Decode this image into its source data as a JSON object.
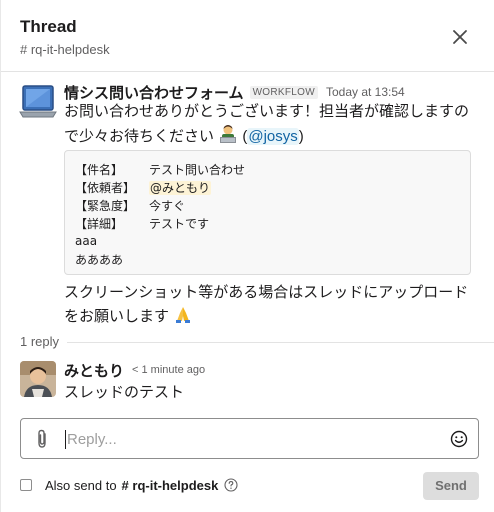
{
  "header": {
    "title": "Thread",
    "channel": "# rq-it-helpdesk",
    "close_icon": "close-icon"
  },
  "parent_message": {
    "sender": "情シス問い合わせフォーム",
    "badge": "WORKFLOW",
    "time": "Today at 13:54",
    "avatar_icon": "laptop-icon",
    "line1": "お問い合わせありがとうございます！担当者が確認しますの",
    "line2_text": "で少々お待ちください",
    "line2_emoji": "person-at-laptop-emoji",
    "line2_paren_open": " (",
    "line2_mention": "@josys",
    "line2_paren_close": ")",
    "form": {
      "rows": [
        {
          "key": "【件名】",
          "value": "テスト問い合わせ"
        },
        {
          "key": "【依頼者】",
          "value": "@みともり"
        },
        {
          "key": "【緊急度】",
          "value": "今すぐ"
        },
        {
          "key": "【詳細】",
          "value": "テストです"
        }
      ],
      "extra1": "aaa",
      "extra2": "ああああ"
    },
    "footer_line1": "スクリーンショット等がある場合はスレッドにアップロード",
    "footer_line2": "をお願いします",
    "footer_emoji": "folded-hands-emoji"
  },
  "replies": {
    "count_label": "1 reply"
  },
  "reply_message": {
    "sender": "みともり",
    "time": "< 1 minute ago",
    "text": "スレッドのテスト",
    "avatar": "user-avatar"
  },
  "composer": {
    "placeholder": "Reply...",
    "value": "",
    "attach_icon": "paperclip-icon",
    "emoji_icon": "smiley-icon"
  },
  "footer": {
    "also_send_label": "Also send to",
    "also_send_channel": "# rq-it-helpdesk",
    "help_icon": "help-icon",
    "send_label": "Send"
  },
  "colors": {
    "mention": "#1264a3",
    "mention_bg": "#e8f5fa",
    "highlight_bg": "#fdf3d6",
    "send_disabled_bg": "#dddddd"
  }
}
